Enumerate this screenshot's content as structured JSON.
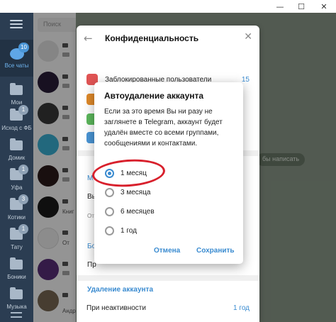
{
  "window": {
    "minimize": "—",
    "maximize": "☐",
    "close": "✕"
  },
  "rail": {
    "items": [
      {
        "label": "Все чаты",
        "badge": "10",
        "active": true
      },
      {
        "label": "Мои",
        "badge": ""
      },
      {
        "label": "Исход с ФБ",
        "badge": "1"
      },
      {
        "label": "Домик",
        "badge": ""
      },
      {
        "label": "Уфа",
        "badge": "1"
      },
      {
        "label": "Котики",
        "badge": "3"
      },
      {
        "label": "Тату",
        "badge": "1"
      },
      {
        "label": "Боники",
        "badge": ""
      },
      {
        "label": "Музыка",
        "badge": ""
      }
    ]
  },
  "chatlist": {
    "search_placeholder": "Поиск",
    "snippets": [
      "Книг",
      "От",
      "Андрей"
    ]
  },
  "chat_area": {
    "hint": "бы написать"
  },
  "privacy": {
    "title": "Конфиденциальность",
    "blocked_label": "Заблокированные пользователи",
    "blocked_count": "15",
    "partials": {
      "p1": "М",
      "p2": "Вы",
      "p3": "От",
      "p4": "Бо",
      "p5": "Пр"
    },
    "account_deletion_section": "Удаление аккаунта",
    "inactive_label": "При неактивности",
    "inactive_value": "1 год"
  },
  "modal": {
    "title": "Автоудаление аккаунта",
    "text": "Если за это время Вы ни разу не заглянете в Telegram, аккаунт будет удалён вместе со всеми группами, сообщениями и контактами.",
    "options": [
      {
        "label": "1 месяц",
        "checked": true
      },
      {
        "label": "3 месяца",
        "checked": false
      },
      {
        "label": "6 месяцев",
        "checked": false
      },
      {
        "label": "1 год",
        "checked": false
      }
    ],
    "cancel": "Отмена",
    "save": "Сохранить"
  },
  "colors": {
    "accent": "#3a8bd0",
    "rail": "#2b3d52",
    "annotation": "#d8202c"
  }
}
